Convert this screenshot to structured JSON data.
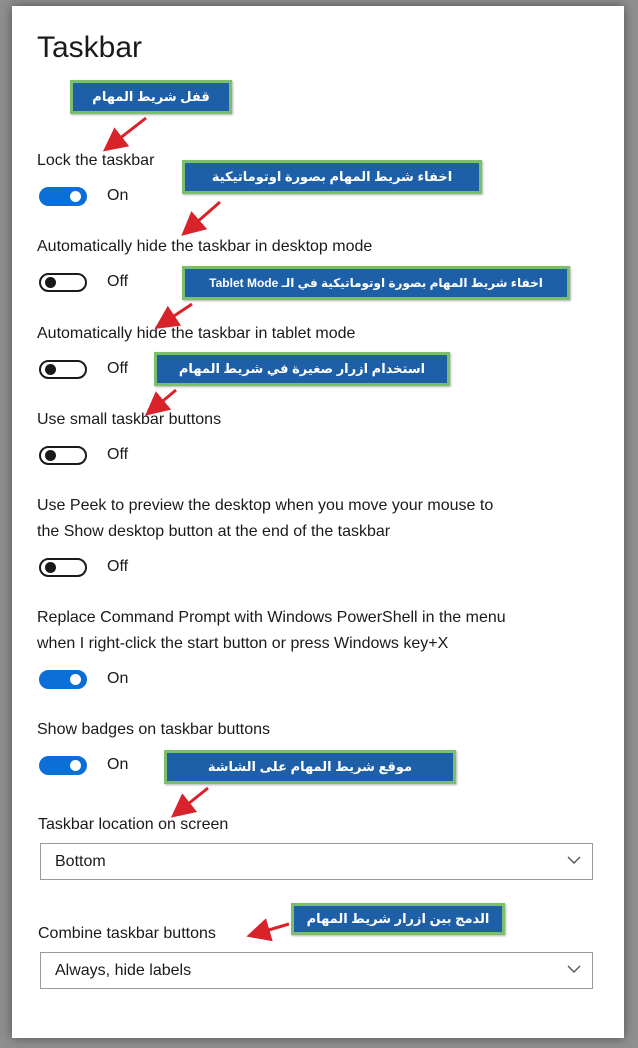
{
  "header": {
    "title": "Taskbar"
  },
  "settings": [
    {
      "label": "Lock the taskbar",
      "state": "On"
    },
    {
      "label": "Automatically hide the taskbar in desktop mode",
      "state": "Off"
    },
    {
      "label": "Automatically hide the taskbar in tablet mode",
      "state": "Off"
    },
    {
      "label": "Use small taskbar buttons",
      "state": "Off"
    },
    {
      "label_line1": "Use Peek to preview the desktop when you move your mouse to",
      "label_line2": "the Show desktop button at the end of the taskbar",
      "state": "Off"
    },
    {
      "label_line1": "Replace Command Prompt with Windows PowerShell in the menu",
      "label_line2": "when I right-click the start button or press Windows key+X",
      "state": "On"
    },
    {
      "label": "Show badges on taskbar buttons",
      "state": "On"
    }
  ],
  "location": {
    "label": "Taskbar location on screen",
    "value": "Bottom"
  },
  "combine": {
    "label": "Combine taskbar buttons",
    "value": "Always, hide labels"
  },
  "annotations": [
    "قفل شريط المهام",
    "اخفاء شريط المهام بصورة اوتوماتيكية",
    "اخفاء شريط المهام بصورة اوتوماتيكية في الـ Tablet Mode",
    "استخدام ازرار صغيرة في شريط المهام",
    "موقع شريط المهام على الشاشة",
    "الدمج بين ازرار شريط المهام"
  ],
  "colors": {
    "accent": "#0a6fd6",
    "annotation_bg": "#1e60a8",
    "annotation_border": "#7bbf6e",
    "arrow": "#d9232a"
  },
  "icons": {
    "dropdown": "chevron-down-icon",
    "pointer": "red-arrow"
  }
}
